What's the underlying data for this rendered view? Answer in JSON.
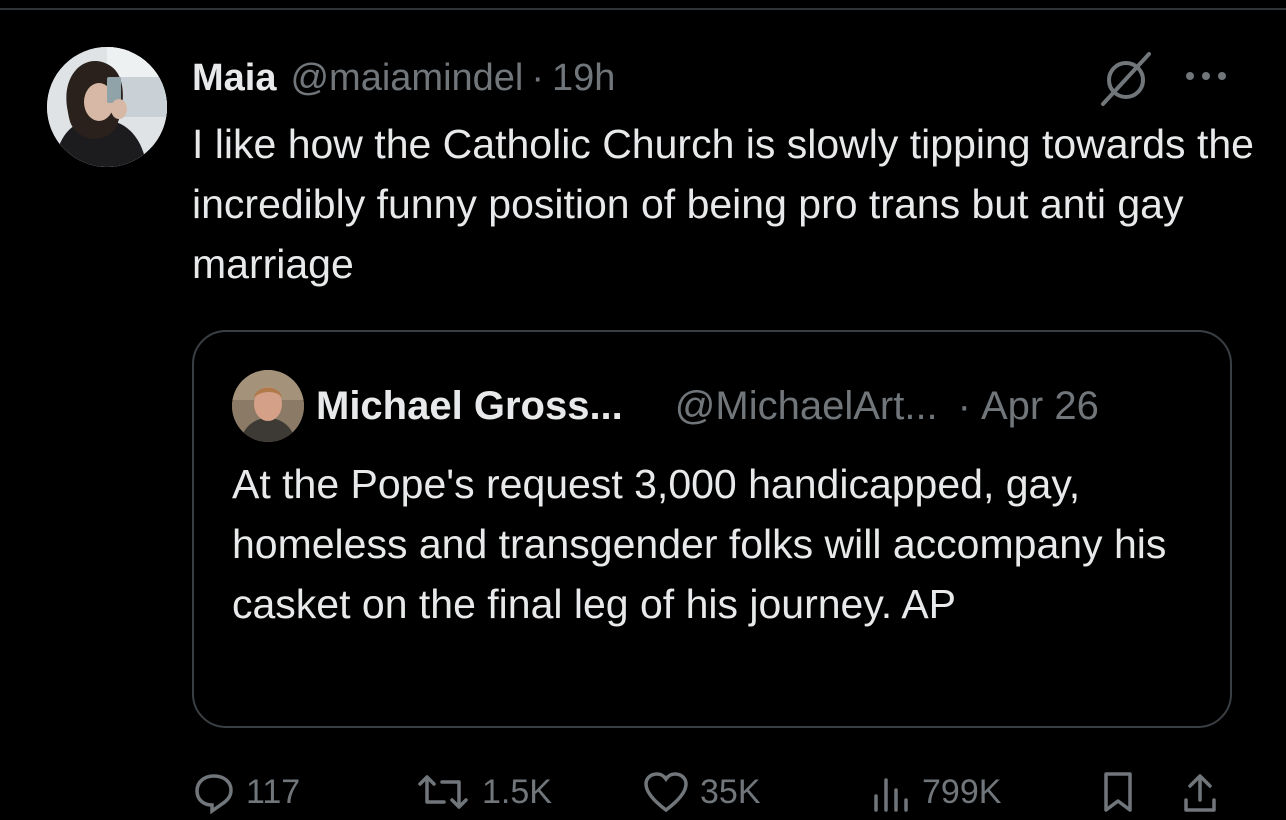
{
  "tweet": {
    "author_name": "Maia",
    "author_handle": "@maiamindel",
    "separator": "·",
    "time": "19h",
    "text": "I like how the Catholic Church is slowly tipping towards the incredibly funny position of being pro trans but anti gay marriage"
  },
  "quoted": {
    "author_name": "Michael Gross...",
    "author_handle": "@MichaelArt...",
    "separator": "·",
    "time": "Apr 26",
    "text": "At the Pope's request 3,000 handicapped, gay, homeless and transgender folks will accompany his casket on the final leg of his journey. AP"
  },
  "actions": {
    "replies": "117",
    "reposts": "1.5K",
    "likes": "35K",
    "views": "799K"
  },
  "icons": {
    "grok": "grok-icon",
    "more": "more-options-icon",
    "reply": "reply-icon",
    "repost": "repost-icon",
    "like": "heart-icon",
    "views": "views-chart-icon",
    "bookmark": "bookmark-icon",
    "share": "share-icon"
  },
  "colors": {
    "background": "#000000",
    "text": "#e7e9ea",
    "muted": "#71767b",
    "border": "#3a3f44"
  }
}
